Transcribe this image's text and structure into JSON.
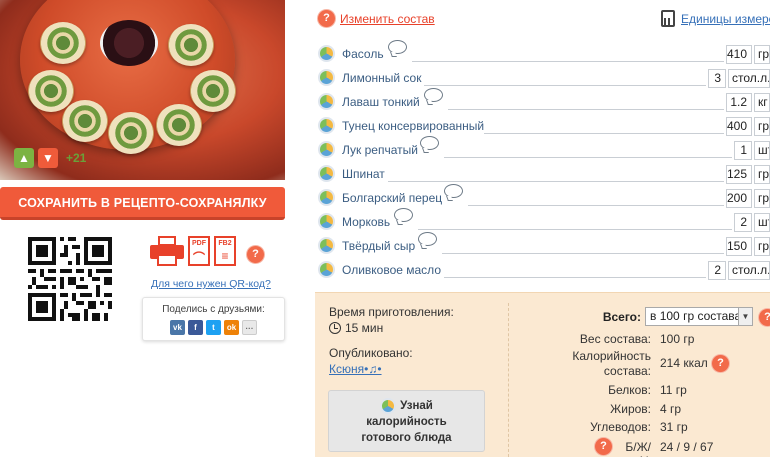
{
  "recipe": {
    "vote_score": "+21",
    "save_button": "СОХРАНИТЬ В РЕЦЕПТО-СОХРАНЯЛКУ",
    "qr_link": "Для чего нужен QR-код?",
    "share_label": "Поделись с друзьями:",
    "export_labels": {
      "pdf": "PDF",
      "fb2": "FB2"
    },
    "share_icons": [
      {
        "name": "vk",
        "label": "vk",
        "color": "#4a76a8"
      },
      {
        "name": "fb",
        "label": "f",
        "color": "#3b5998"
      },
      {
        "name": "tw",
        "label": "t",
        "color": "#1da1f2"
      },
      {
        "name": "ok",
        "label": "ok",
        "color": "#ee8208"
      },
      {
        "name": "more",
        "label": "···",
        "color": "#e9e9e9"
      }
    ]
  },
  "toolbar": {
    "change_composition": "Изменить состав",
    "units": "Единицы измерения"
  },
  "ingredients": [
    {
      "name": "Фасоль",
      "qty": "410",
      "unit": "гр",
      "comment": true
    },
    {
      "name": "Лимонный сок",
      "qty": "3",
      "unit": "стол.л.",
      "comment": false
    },
    {
      "name": "Лаваш тонкий",
      "qty": "1.2",
      "unit": "кг",
      "comment": true
    },
    {
      "name": "Тунец консервированный",
      "qty": "400",
      "unit": "гр",
      "comment": false
    },
    {
      "name": "Лук репчатый",
      "qty": "1",
      "unit": "шт.",
      "comment": true
    },
    {
      "name": "Шпинат",
      "qty": "125",
      "unit": "гр",
      "comment": false
    },
    {
      "name": "Болгарский перец",
      "qty": "200",
      "unit": "гр",
      "comment": true
    },
    {
      "name": "Морковь",
      "qty": "2",
      "unit": "шт.",
      "comment": true
    },
    {
      "name": "Твёрдый сыр",
      "qty": "150",
      "unit": "гр",
      "comment": true
    },
    {
      "name": "Оливковое масло",
      "qty": "2",
      "unit": "стол.л.",
      "comment": false
    }
  ],
  "info": {
    "time_label": "Время приготовления:",
    "time_value": "15 мин",
    "published_label": "Опубликовано:",
    "author": "Ксюня•♫•",
    "calorie_button": [
      "Узнай",
      "калорийность",
      "готового блюда"
    ],
    "total_label": "Всего:",
    "total_select": "в 100 гр состава",
    "rows": [
      {
        "label": "Вес состава:",
        "value": "100 гр"
      },
      {
        "label": "Калорийность состава:",
        "value": "214 ккал"
      },
      {
        "label": "Белков:",
        "value": "11 гр"
      },
      {
        "label": "Жиров:",
        "value": "4 гр"
      },
      {
        "label": "Углеводов:",
        "value": "31 гр"
      },
      {
        "label": "Б/Ж/У:",
        "value": "24 / 9 / 67"
      }
    ]
  }
}
